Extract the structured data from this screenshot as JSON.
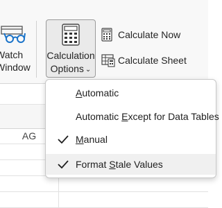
{
  "ribbon": {
    "watch": {
      "line1": "Watch",
      "line2": "Window",
      "icon": "glasses-icon"
    },
    "calculation_options": {
      "line1": "Calculation",
      "line2": "Options",
      "chevron": "⌄",
      "icon": "calculator-icon"
    },
    "calculate_now": {
      "label": "Calculate Now",
      "icon": "calculator-small-icon"
    },
    "calculate_sheet": {
      "label": "Calculate Sheet",
      "icon": "sheet-calculator-icon"
    }
  },
  "sheet": {
    "column_header": "AG"
  },
  "menu": {
    "items": [
      {
        "pre": "",
        "u": "A",
        "post": "utomatic",
        "checked": false
      },
      {
        "pre": "Automatic ",
        "u": "E",
        "post": "xcept for Data Tables",
        "checked": false
      },
      {
        "pre": "",
        "u": "M",
        "post": "anual",
        "checked": true
      },
      {
        "pre": "Format ",
        "u": "S",
        "post": "tale Values",
        "checked": true
      }
    ]
  },
  "colors": {
    "accent_blue": "#1a73c9",
    "ribbon_bg": "#f8f8f8",
    "menu_hover": "#f0f0f0"
  }
}
